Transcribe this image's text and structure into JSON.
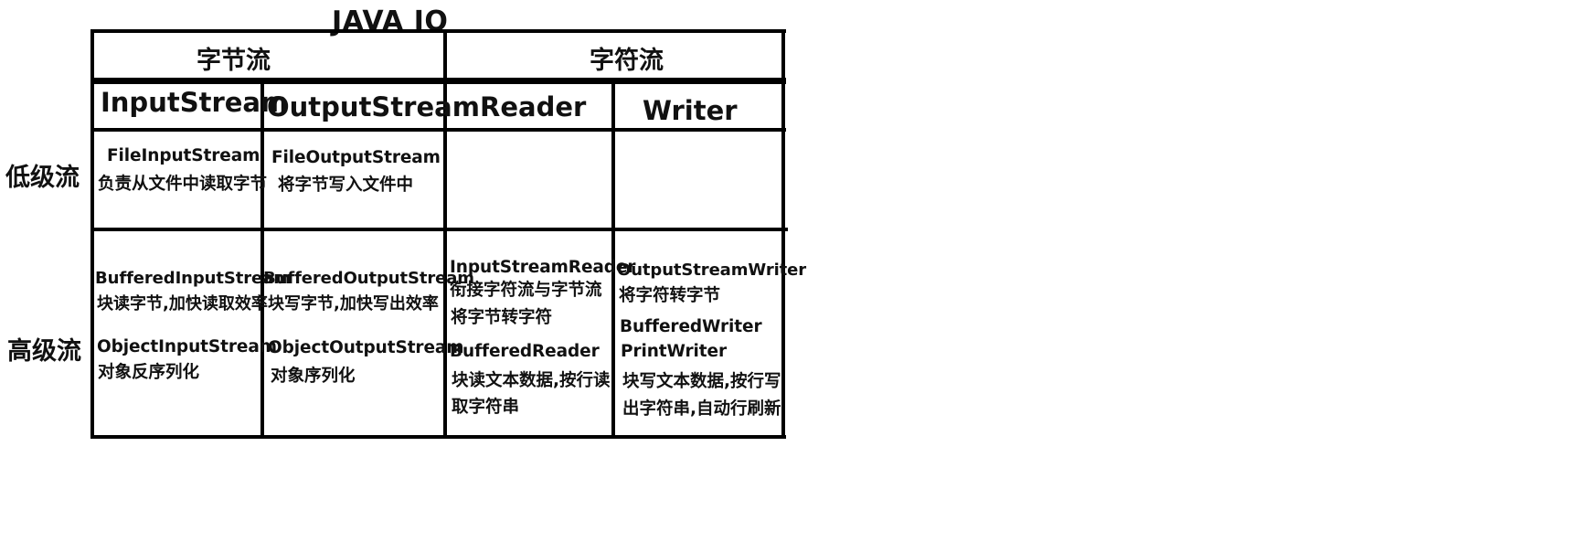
{
  "title": "JAVA IO",
  "groups": {
    "byte": "字节流",
    "char": "字符流"
  },
  "columns": {
    "input_stream": "InputStream",
    "output_stream": "OutputStream",
    "reader": "Reader",
    "writer": "Writer"
  },
  "rows": {
    "low": "低级流",
    "high": "高级流"
  },
  "cells": {
    "low_input": {
      "class": "FileInputStream",
      "desc": "负责从文件中读取字节"
    },
    "low_output": {
      "class": "FileOutputStream",
      "desc": "将字节写入文件中"
    },
    "high_input": {
      "buffered_class": "BufferedInputStream",
      "buffered_desc": "块读字节,加快读取效率",
      "object_class": "ObjectInputStream",
      "object_desc": "对象反序列化"
    },
    "high_output": {
      "buffered_class": "BufferedOutputStream",
      "buffered_desc": "块写字节,加快写出效率",
      "object_class": "ObjectOutputStream",
      "object_desc": "对象序列化"
    },
    "high_reader": {
      "isr_class": "InputStreamReader",
      "isr_desc1": "衔接字符流与字节流",
      "isr_desc2": "将字节转字符",
      "br_class": "BufferedReader",
      "br_desc1": "块读文本数据,按行读",
      "br_desc2": "取字符串"
    },
    "high_writer": {
      "osw_class": "OutputStreamWriter",
      "osw_desc": "将字符转字节",
      "bw_class": "BufferedWriter",
      "pw_class": "PrintWriter",
      "desc1": "块写文本数据,按行写",
      "desc2": "出字符串,自动行刷新"
    }
  }
}
